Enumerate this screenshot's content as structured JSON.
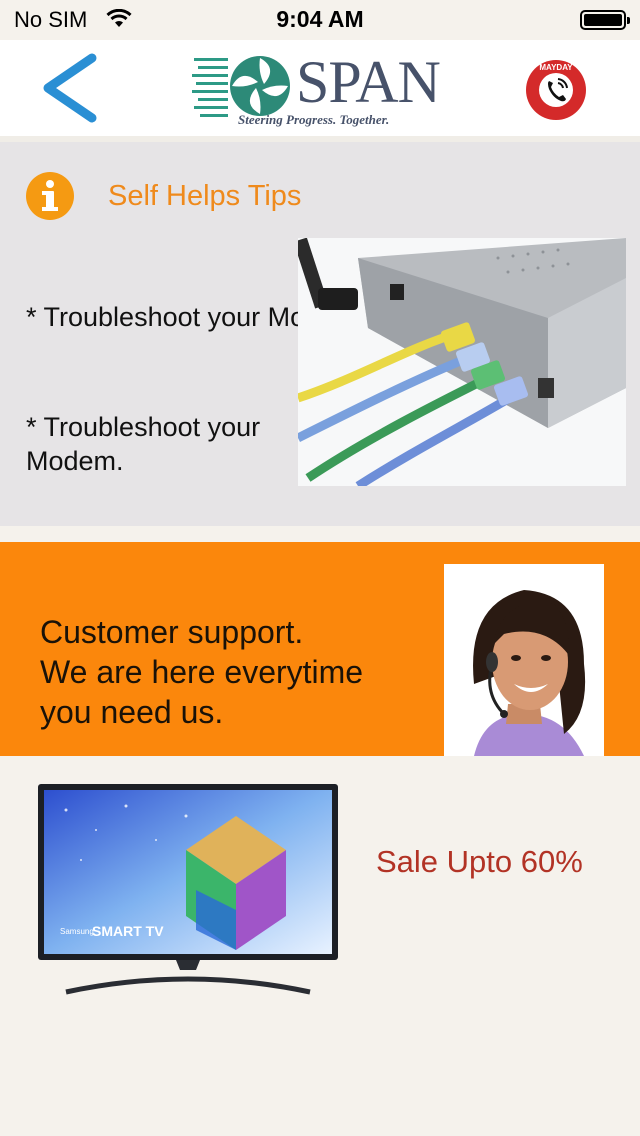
{
  "status_bar": {
    "carrier": "No SIM",
    "time": "9:04 AM"
  },
  "header": {
    "logo": {
      "name": "SPAN",
      "tagline": "Steering Progress. Together."
    },
    "mayday_badge": "MAYDAY",
    "colors": {
      "back_arrow": "#2a8fd4",
      "logo": "#47526a",
      "mayday": "#d42a2a"
    }
  },
  "self_help": {
    "icon": "info-icon",
    "title": "Self Helps Tips",
    "tips": [
      "* Troubleshoot your Modem.",
      "* Troubleshoot your Modem."
    ],
    "image": "router-with-cables",
    "colors": {
      "title": "#ef8a1c",
      "background": "#e6e4e6"
    }
  },
  "support": {
    "lines": [
      "Customer support.",
      "We are here everytime you need us."
    ],
    "image": "support-agent-headset",
    "colors": {
      "background": "#fb870c"
    }
  },
  "sale": {
    "text": "Sale Upto 60%",
    "image": "samsung-smart-tv",
    "tv_brand": "Samsung",
    "tv_logo": "SMART TV",
    "colors": {
      "text": "#b23325"
    }
  }
}
